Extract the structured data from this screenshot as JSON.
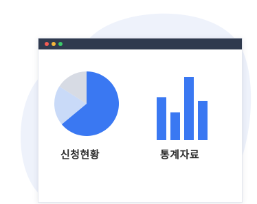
{
  "colors": {
    "blob": "#eef2fb",
    "titlebar": "#2f3a4e",
    "dot_red": "#f25c54",
    "dot_yellow": "#f6b73c",
    "dot_green": "#3bc96b",
    "pie_main": "#3a78f2",
    "pie_gray": "#d7dbe4",
    "pie_light": "#c9daf8",
    "bar": "#3a78f2",
    "text": "#2b2b2b"
  },
  "cards": {
    "application_status": {
      "label": "신청현황",
      "icon": "pie-chart-icon"
    },
    "statistics": {
      "label": "통계자료",
      "icon": "bar-chart-icon"
    }
  },
  "pie_shares": [
    0.64,
    0.2,
    0.16
  ],
  "bar_levels": [
    0.68,
    0.44,
    1.0,
    0.62
  ]
}
